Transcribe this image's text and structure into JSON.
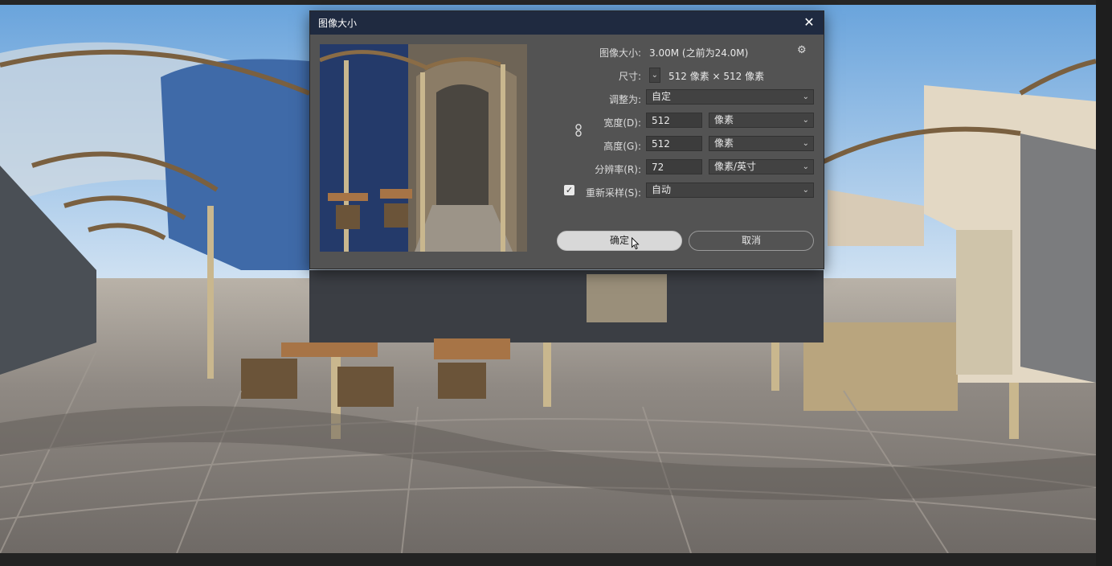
{
  "dialog": {
    "title": "图像大小",
    "close_icon": "close-icon",
    "image_size_label": "图像大小:",
    "image_size_value": "3.00M (之前为24.0M)",
    "settings_icon": "gear-icon",
    "dimensions_label": "尺寸:",
    "dimensions_value": "512 像素 × 512 像素",
    "fit_to_label": "调整为:",
    "fit_to_value": "自定",
    "width_label": "宽度(D):",
    "width_value": "512",
    "width_unit": "像素",
    "height_label": "高度(G):",
    "height_value": "512",
    "height_unit": "像素",
    "resolution_label": "分辨率(R):",
    "resolution_value": "72",
    "resolution_unit": "像素/英寸",
    "resample_label": "重新采样(S):",
    "resample_checked": true,
    "resample_value": "自动",
    "ok_label": "确定",
    "cancel_label": "取消",
    "link_icon": "link-icon"
  },
  "colors": {
    "titlebar": "#1f2a40",
    "dialog_bg": "#535353",
    "field_bg": "#3c3c3c"
  }
}
